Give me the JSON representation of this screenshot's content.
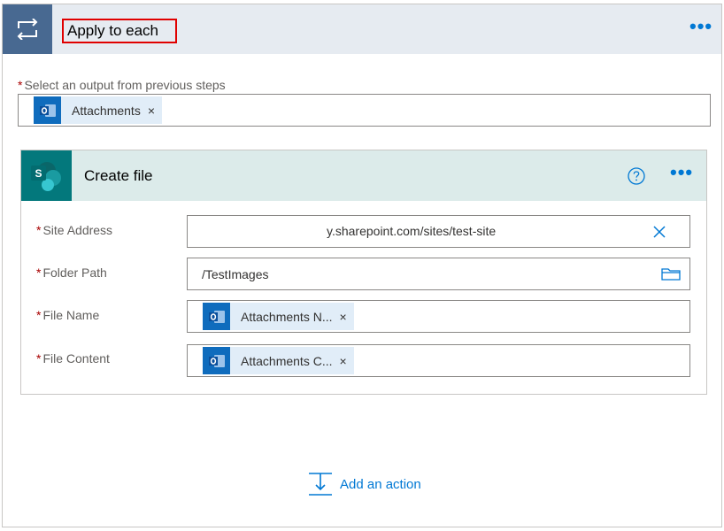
{
  "loop": {
    "title": "Apply to each",
    "more_label": "•••",
    "select_label": "Select an output from previous steps",
    "required_mark": "*",
    "select_token": {
      "label": "Attachments",
      "remove": "×",
      "icon": "outlook-icon"
    }
  },
  "action": {
    "title": "Create file",
    "icon": "sharepoint-icon",
    "help_icon": "help-icon",
    "more_label": "•••",
    "fields": [
      {
        "label": "Site Address",
        "value": "y.sharepoint.com/sites/test-site",
        "clear_icon": "clear-icon"
      },
      {
        "label": "Folder Path",
        "value": "/TestImages",
        "picker_icon": "folder-icon"
      },
      {
        "label": "File Name",
        "token": {
          "label": "Attachments N...",
          "remove": "×"
        }
      },
      {
        "label": "File Content",
        "token": {
          "label": "Attachments C...",
          "remove": "×"
        }
      }
    ]
  },
  "add_action": {
    "label": "Add an action",
    "icon": "insert-step-icon"
  },
  "colors": {
    "loop_header_bg": "#e6ebf1",
    "loop_icon_bg": "#486991",
    "action_header_bg": "#dcebea",
    "sharepoint_bg": "#03787c",
    "accent": "#0078d4",
    "highlight_border": "#e00000"
  }
}
